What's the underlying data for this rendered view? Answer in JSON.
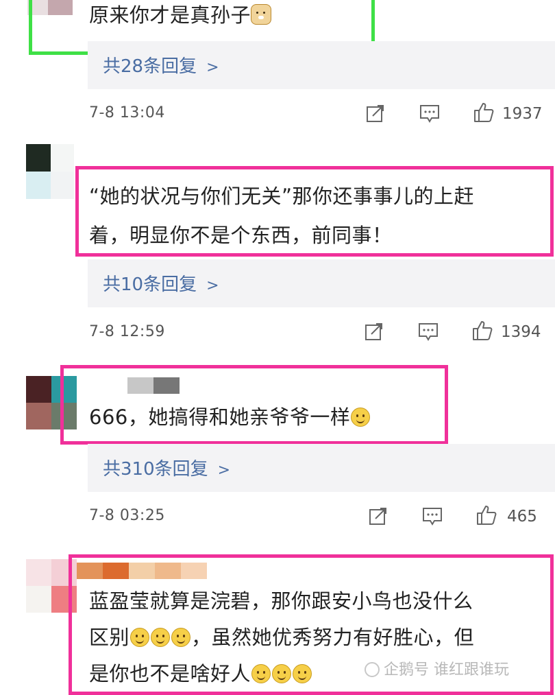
{
  "comments": [
    {
      "text": "原来你才是真孙子",
      "emoji": "doge",
      "reply_label": "共28条回复",
      "time": "7-8 13:04",
      "likes": "1937"
    },
    {
      "text": "“她的状况与你们无关”那你还事事儿的上赶着，明显你不是个东西，前同事！",
      "text_line1": "“她的状况与你们无关”那你还事事儿的上赶",
      "text_line2": "着，明显你不是个东西，前同事！",
      "reply_label": "共10条回复",
      "time": "7-8 12:59",
      "likes": "1394"
    },
    {
      "text": "666，她搞得和她亲爷爷一样",
      "emoji": "smile",
      "reply_label": "共310条回复",
      "time": "7-8 03:25",
      "likes": "465"
    },
    {
      "text_line1": "蓝盈莹就算是浣碧，那你跟安小鸟也没什么",
      "text_line2": "区别",
      "text_line2b": "，虽然她优秀努力有好胜心，但",
      "text_line3": "是你也不是啥好人",
      "emoji": "smile"
    }
  ],
  "icons": {
    "share": "share-icon",
    "comment": "comment-icon",
    "like": "thumbs-up-icon",
    "chevron": "chevron-right-icon"
  },
  "colors": {
    "green_highlight": "#3fe046",
    "pink_highlight": "#f0309a",
    "reply_link": "#4a6da3",
    "reply_bg": "#f3f3f5"
  },
  "watermark": {
    "text": "企鹅号 谁红跟谁玩"
  }
}
